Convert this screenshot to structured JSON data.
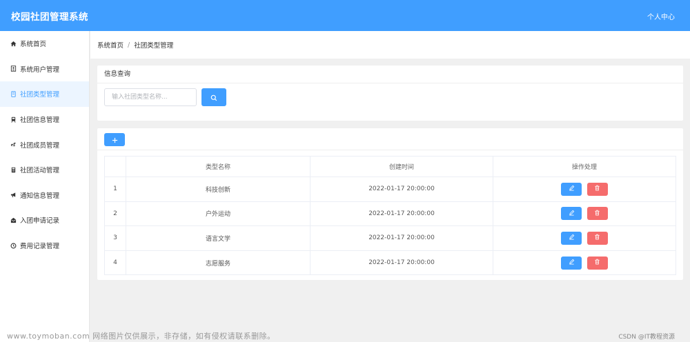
{
  "header": {
    "title": "校园社团管理系统",
    "user_center": "个人中心"
  },
  "sidebar": {
    "items": [
      {
        "label": "系统首页",
        "icon": "home-icon"
      },
      {
        "label": "系统用户管理",
        "icon": "user-card-icon"
      },
      {
        "label": "社团类型管理",
        "icon": "document-icon",
        "active": true
      },
      {
        "label": "社团信息管理",
        "icon": "train-icon"
      },
      {
        "label": "社团成员管理",
        "icon": "cubes-icon"
      },
      {
        "label": "社团活动管理",
        "icon": "calculator-icon"
      },
      {
        "label": "通知信息管理",
        "icon": "bullhorn-icon"
      },
      {
        "label": "入团申请记录",
        "icon": "envelope-open-icon"
      },
      {
        "label": "费用记录管理",
        "icon": "clock-icon"
      }
    ]
  },
  "breadcrumb": {
    "home": "系统首页",
    "separator": "/",
    "current": "社团类型管理"
  },
  "search": {
    "title": "信息查询",
    "placeholder": "输入社团类型名称..."
  },
  "table": {
    "headers": [
      "",
      "类型名称",
      "创建时间",
      "操作处理"
    ],
    "rows": [
      {
        "index": "1",
        "name": "科技创新",
        "created": "2022-01-17 20:00:00"
      },
      {
        "index": "2",
        "name": "户外运动",
        "created": "2022-01-17 20:00:00"
      },
      {
        "index": "3",
        "name": "语言文学",
        "created": "2022-01-17 20:00:00"
      },
      {
        "index": "4",
        "name": "志愿服务",
        "created": "2022-01-17 20:00:00"
      }
    ]
  },
  "watermark": "www.toymoban.com 网络图片仅供展示，非存储，如有侵权请联系删除。",
  "csdn_credit": "CSDN @IT教程资源",
  "colors": {
    "primary": "#409eff",
    "danger": "#f56c6c",
    "active_bg": "#ecf5ff"
  }
}
